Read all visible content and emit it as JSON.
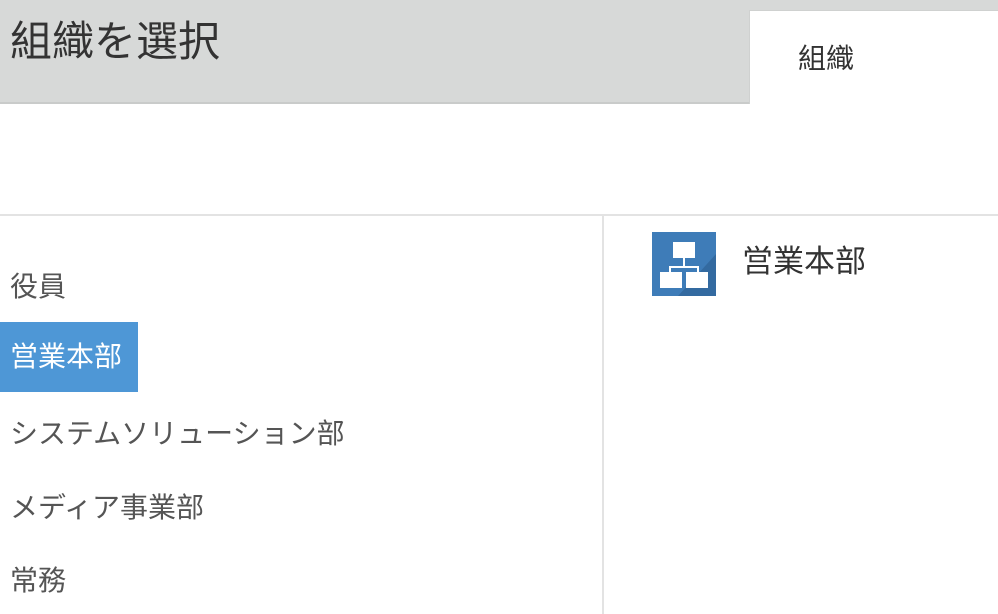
{
  "header": {
    "title": "組織を選択",
    "tab_label": "組織"
  },
  "org_list": {
    "items": [
      {
        "label": "役員",
        "selected": false
      },
      {
        "label": "営業本部",
        "selected": true
      },
      {
        "label": "システムソリューション部",
        "selected": false
      },
      {
        "label": "メディア事業部",
        "selected": false
      },
      {
        "label": "常務",
        "selected": false
      }
    ]
  },
  "result": {
    "label": "営業本部",
    "icon": "org-chart-icon"
  },
  "colors": {
    "header_bg": "#d7d9d8",
    "selected_bg": "#4e97d6",
    "icon_bg": "#3e7cb8"
  }
}
